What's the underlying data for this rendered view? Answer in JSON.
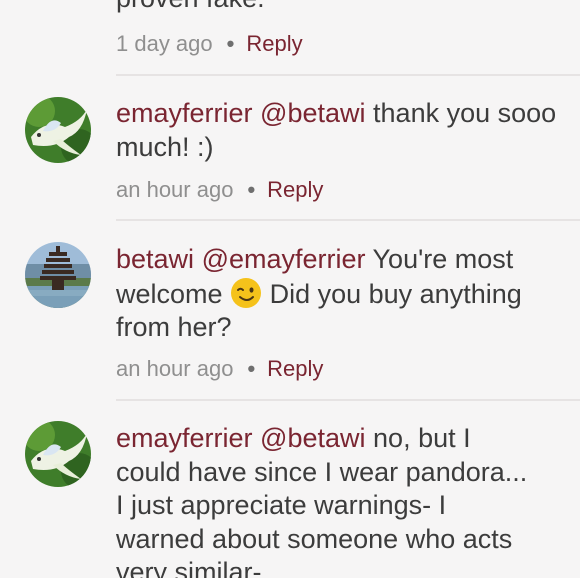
{
  "comments": [
    {
      "text_tail": "proven fake.",
      "time": "1 day ago",
      "reply": "Reply"
    },
    {
      "author": "emayferrier",
      "mention": "@betawi",
      "text": "thank you sooo much! :)",
      "time": "an hour ago",
      "reply": "Reply",
      "avatar_icon": "betta-fish-avatar"
    },
    {
      "author": "betawi",
      "mention": "@emayferrier",
      "text_before": "You're most welcome",
      "emoji": "winking-face",
      "text_after": "Did you buy anything from her?",
      "time": "an hour ago",
      "reply": "Reply",
      "avatar_icon": "temple-avatar"
    },
    {
      "author": "emayferrier",
      "mention": "@betawi",
      "text": "no, but I could have since I wear pandora... I just appreciate warnings- I warned about someone who acts very similar-",
      "avatar_icon": "betta-fish-avatar"
    }
  ],
  "separator": "•",
  "colors": {
    "author": "#7a2531",
    "body_text": "#3c3c3c",
    "meta_text": "#8f8f8f",
    "divider": "#e6e3e3",
    "background": "#f6f5f5"
  }
}
